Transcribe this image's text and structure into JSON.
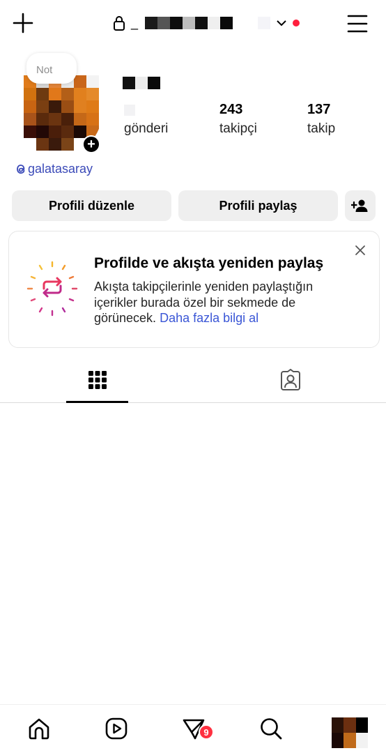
{
  "header": {
    "username_prefix": "_",
    "colors": {
      "notification_dot": "#ff1f3d"
    },
    "icons": {
      "left": "plus-icon",
      "lock": "lock-icon",
      "dropdown": "chevron-down-icon",
      "right": "hamburger-menu-icon"
    }
  },
  "profile": {
    "note_text": "Not",
    "posts_count": "",
    "posts_label": "gönderi",
    "followers_count": "243",
    "followers_label": "takipçi",
    "following_count": "137",
    "following_label": "takip",
    "threads_handle": "galatasaray"
  },
  "actions": {
    "edit_profile": "Profili düzenle",
    "share_profile": "Profili paylaş",
    "discover_people_icon": "add-person-icon"
  },
  "repost_card": {
    "title": "Profilde ve akışta yeniden paylaş",
    "body": "Akışta takipçilerinle yeniden paylaştığın içerikler burada özel bir sekmede de görünecek.",
    "link": "Daha fazla bilgi al",
    "icon": "repost-icon"
  },
  "tabs": [
    {
      "icon": "grid-icon",
      "selected": true
    },
    {
      "icon": "tagged-icon",
      "selected": false
    }
  ],
  "bottom_nav": {
    "items": [
      "home-icon",
      "reels-icon",
      "direct-messages-icon",
      "search-icon",
      "profile-avatar"
    ],
    "messages_badge": "9",
    "badge_color": "#ff3040"
  }
}
